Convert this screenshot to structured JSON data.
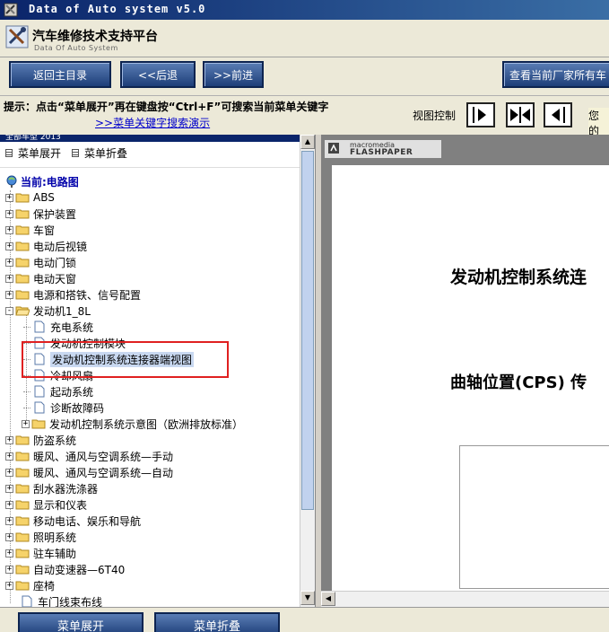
{
  "window": {
    "title": "Data of Auto system v5.0"
  },
  "header": {
    "title": "汽车维修技术支持平台",
    "subtitle": "Data Of Auto System"
  },
  "toolbar": {
    "home_label": "返回主目录",
    "back_label": "<<后退",
    "forward_label": ">>前进",
    "view_all_label": "查看当前厂家所有车"
  },
  "hintbar": {
    "hint": "提示：点击“菜单展开”再在键盘按“Ctrl+F”可搜索当前菜单关键字",
    "demo_link": ">>菜单关键字搜索演示",
    "view_control_label": "视图控制",
    "user_label": "您的"
  },
  "tree": {
    "top_label": "全部车型  2013",
    "expand_label": "菜单展开",
    "collapse_label": "菜单折叠",
    "current_label": "当前:电路图",
    "items_before": [
      "ABS",
      "保护装置",
      "车窗",
      "电动后视镜",
      "电动门锁",
      "电动天窗",
      "电源和搭铁、信号配置"
    ],
    "engine_label": "发动机1_8L",
    "engine_children": [
      "充电系统",
      "发动机控制模块",
      "发动机控制系统连接器端视图",
      "冷却风扇",
      "起动系统",
      "诊断故障码"
    ],
    "engine_subfolder": "发动机控制系统示意图（欧洲排放标准）",
    "items_after": [
      "防盗系统",
      "暖风、通风与空调系统—手动",
      "暖风、通风与空调系统—自动",
      "刮水器洗涤器",
      "显示和仪表",
      "移动电话、娱乐和导航",
      "照明系统",
      "驻车辅助",
      "自动变速器—6T40",
      "座椅"
    ],
    "last_item": "车门线束布线"
  },
  "viewer": {
    "brand_small": "macromedia",
    "brand_large": "FLASHPAPER",
    "doc_title": "发动机控制系统连",
    "doc_subtitle": "曲轴位置(CPS) 传"
  },
  "bottom": {
    "expand_label": "菜单展开",
    "collapse_label": "菜单折叠"
  }
}
